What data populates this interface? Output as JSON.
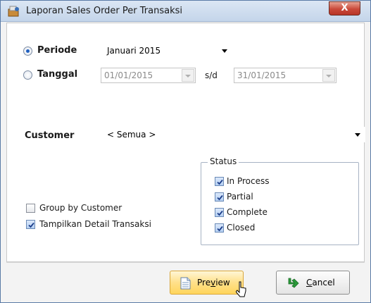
{
  "window": {
    "title": "Laporan Sales Order Per Transaksi",
    "close_label": "X"
  },
  "periode": {
    "label": "Periode",
    "selected": true,
    "value": "Januari 2015"
  },
  "tanggal": {
    "label": "Tanggal",
    "selected": false,
    "from": "01/01/2015",
    "separator": "s/d",
    "to": "31/01/2015"
  },
  "customer": {
    "label": "Customer",
    "value": "< Semua >"
  },
  "options": {
    "group_by_customer": {
      "label": "Group by Customer",
      "checked": false
    },
    "tampilkan_detail": {
      "label": "Tampilkan Detail Transaksi",
      "checked": true
    }
  },
  "status": {
    "legend": "Status",
    "items": [
      {
        "label": "In Process",
        "checked": true
      },
      {
        "label": "Partial",
        "checked": true
      },
      {
        "label": "Complete",
        "checked": true
      },
      {
        "label": "Closed",
        "checked": true
      }
    ]
  },
  "buttons": {
    "preview": {
      "prefix": "Pre",
      "mnemonic": "v",
      "suffix": "iew"
    },
    "cancel": {
      "prefix": "",
      "mnemonic": "C",
      "suffix": "ancel"
    }
  },
  "colors": {
    "accent": "#2060c0",
    "preview_button": "#ffd55c",
    "cancel_icon": "#2a9a3a"
  }
}
